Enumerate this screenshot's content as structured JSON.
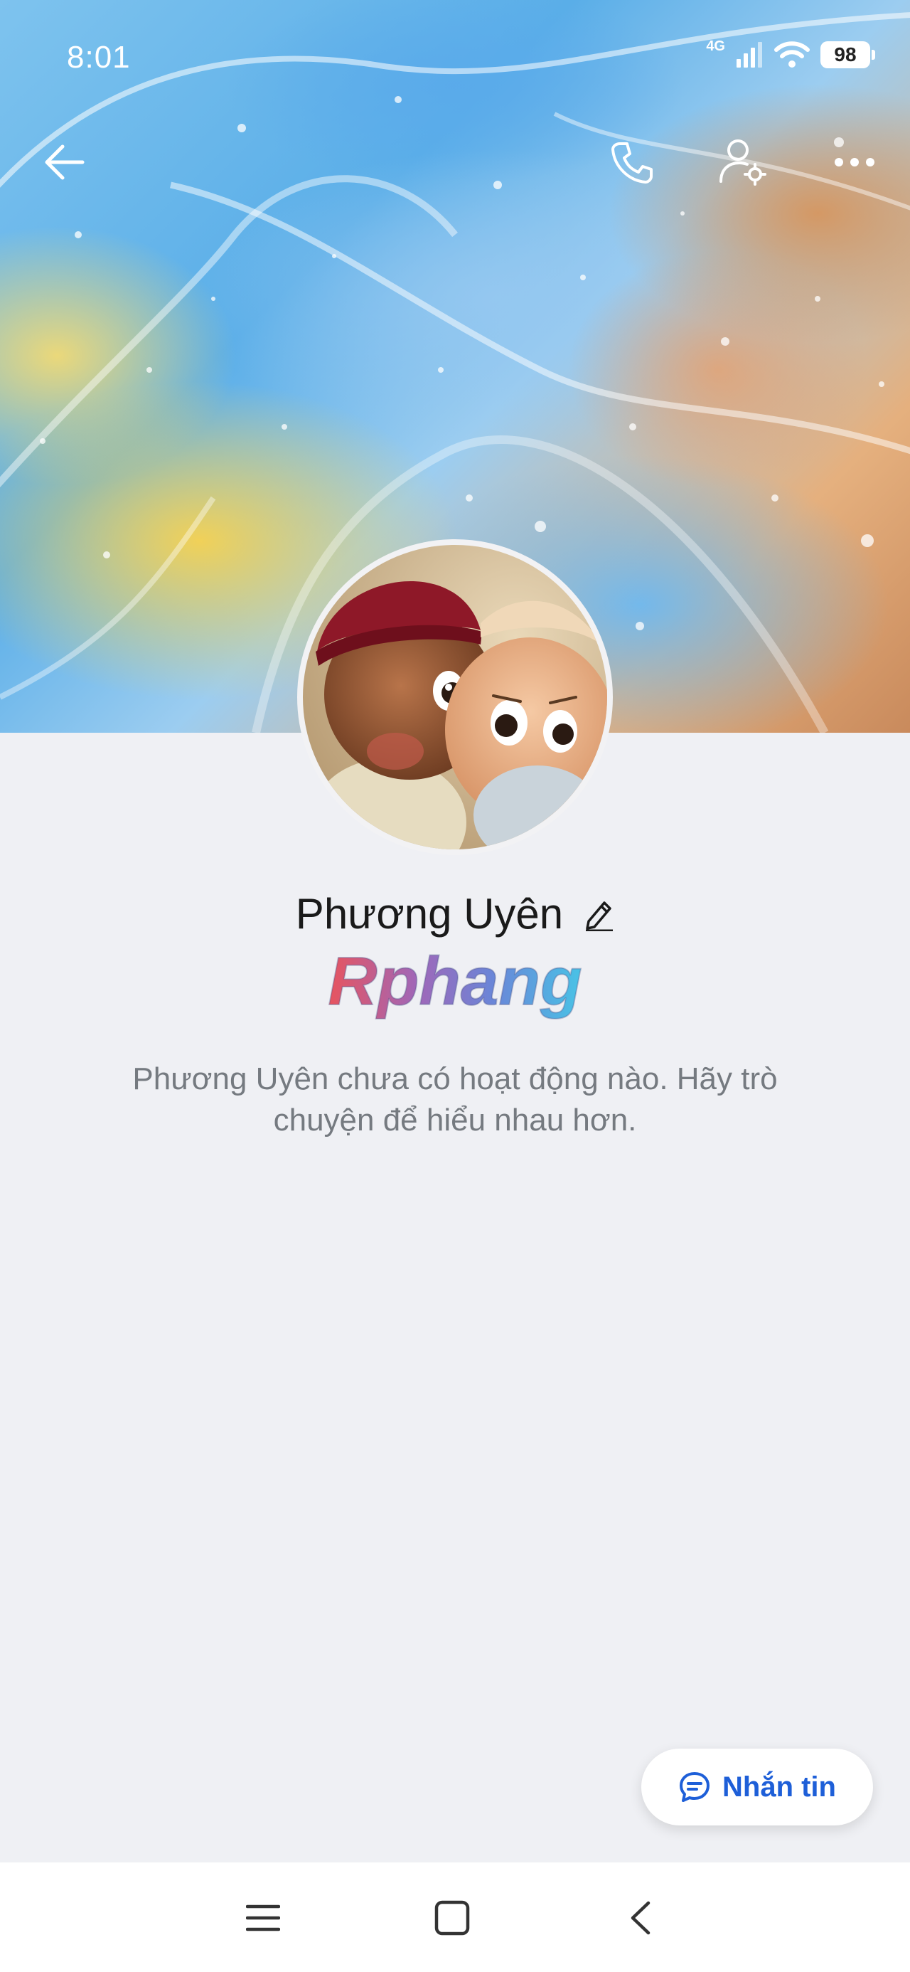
{
  "status_bar": {
    "time": "8:01",
    "network": "4G",
    "battery": "98"
  },
  "header": {
    "back_icon": "arrow-left-icon",
    "call_icon": "phone-icon",
    "settings_icon": "user-settings-icon",
    "more_icon": "more-dots-icon"
  },
  "profile": {
    "name": "Phương Uyên",
    "edit_icon": "pencil-icon",
    "watermark": "Rphang",
    "empty_message": "Phương Uyên chưa có hoạt động nào. Hãy trò chuyện để hiểu nhau hơn."
  },
  "actions": {
    "message_label": "Nhắn tin",
    "message_icon": "chat-bubble-icon"
  },
  "system_nav": {
    "recent_icon": "menu-lines-icon",
    "home_icon": "square-home-icon",
    "back_icon": "chevron-left-icon"
  },
  "colors": {
    "accent": "#1e5fd8",
    "background": "#eff0f4",
    "muted_text": "#757a80"
  }
}
